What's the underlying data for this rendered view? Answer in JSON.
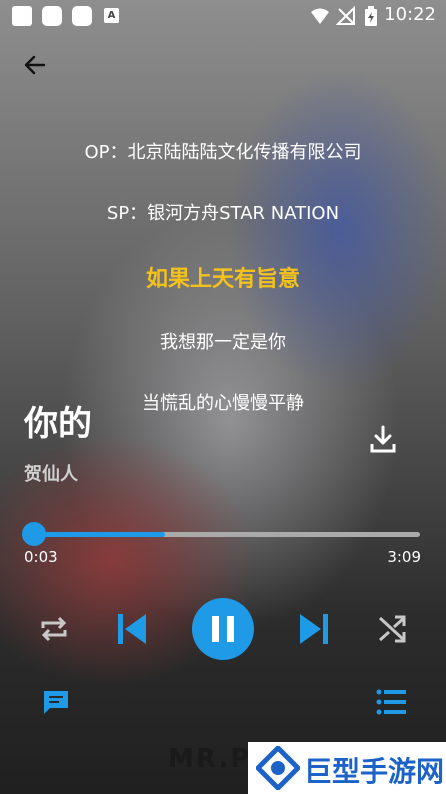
{
  "status_bar": {
    "time": "10:22"
  },
  "lyrics": [
    {
      "text": "OP：北京陆陆陆文化传播有限公司",
      "active": false
    },
    {
      "text": "SP：银河方舟STAR NATION",
      "active": false
    },
    {
      "text": "如果上天有旨意",
      "active": true
    },
    {
      "text": "我想那一定是你",
      "active": false
    },
    {
      "text": "当慌乱的心慢慢平静",
      "active": false
    }
  ],
  "song": {
    "title": "你的",
    "artist": "贺仙人"
  },
  "progress": {
    "current": "0:03",
    "total": "3:09",
    "fraction": 0.34
  },
  "colors": {
    "accent": "#1e9ae6",
    "active_lyric": "#f5c21b",
    "watermark_blue": "#1d63c7"
  },
  "icons": {
    "back": "arrow-left-icon",
    "download": "download-icon",
    "repeat": "repeat-icon",
    "previous": "skip-previous-icon",
    "pause": "pause-icon",
    "next": "skip-next-icon",
    "shuffle": "shuffle-icon",
    "comment": "comment-icon",
    "playlist": "playlist-icon"
  },
  "watermark": {
    "brand": "MR.P",
    "site": "巨型手游网"
  }
}
